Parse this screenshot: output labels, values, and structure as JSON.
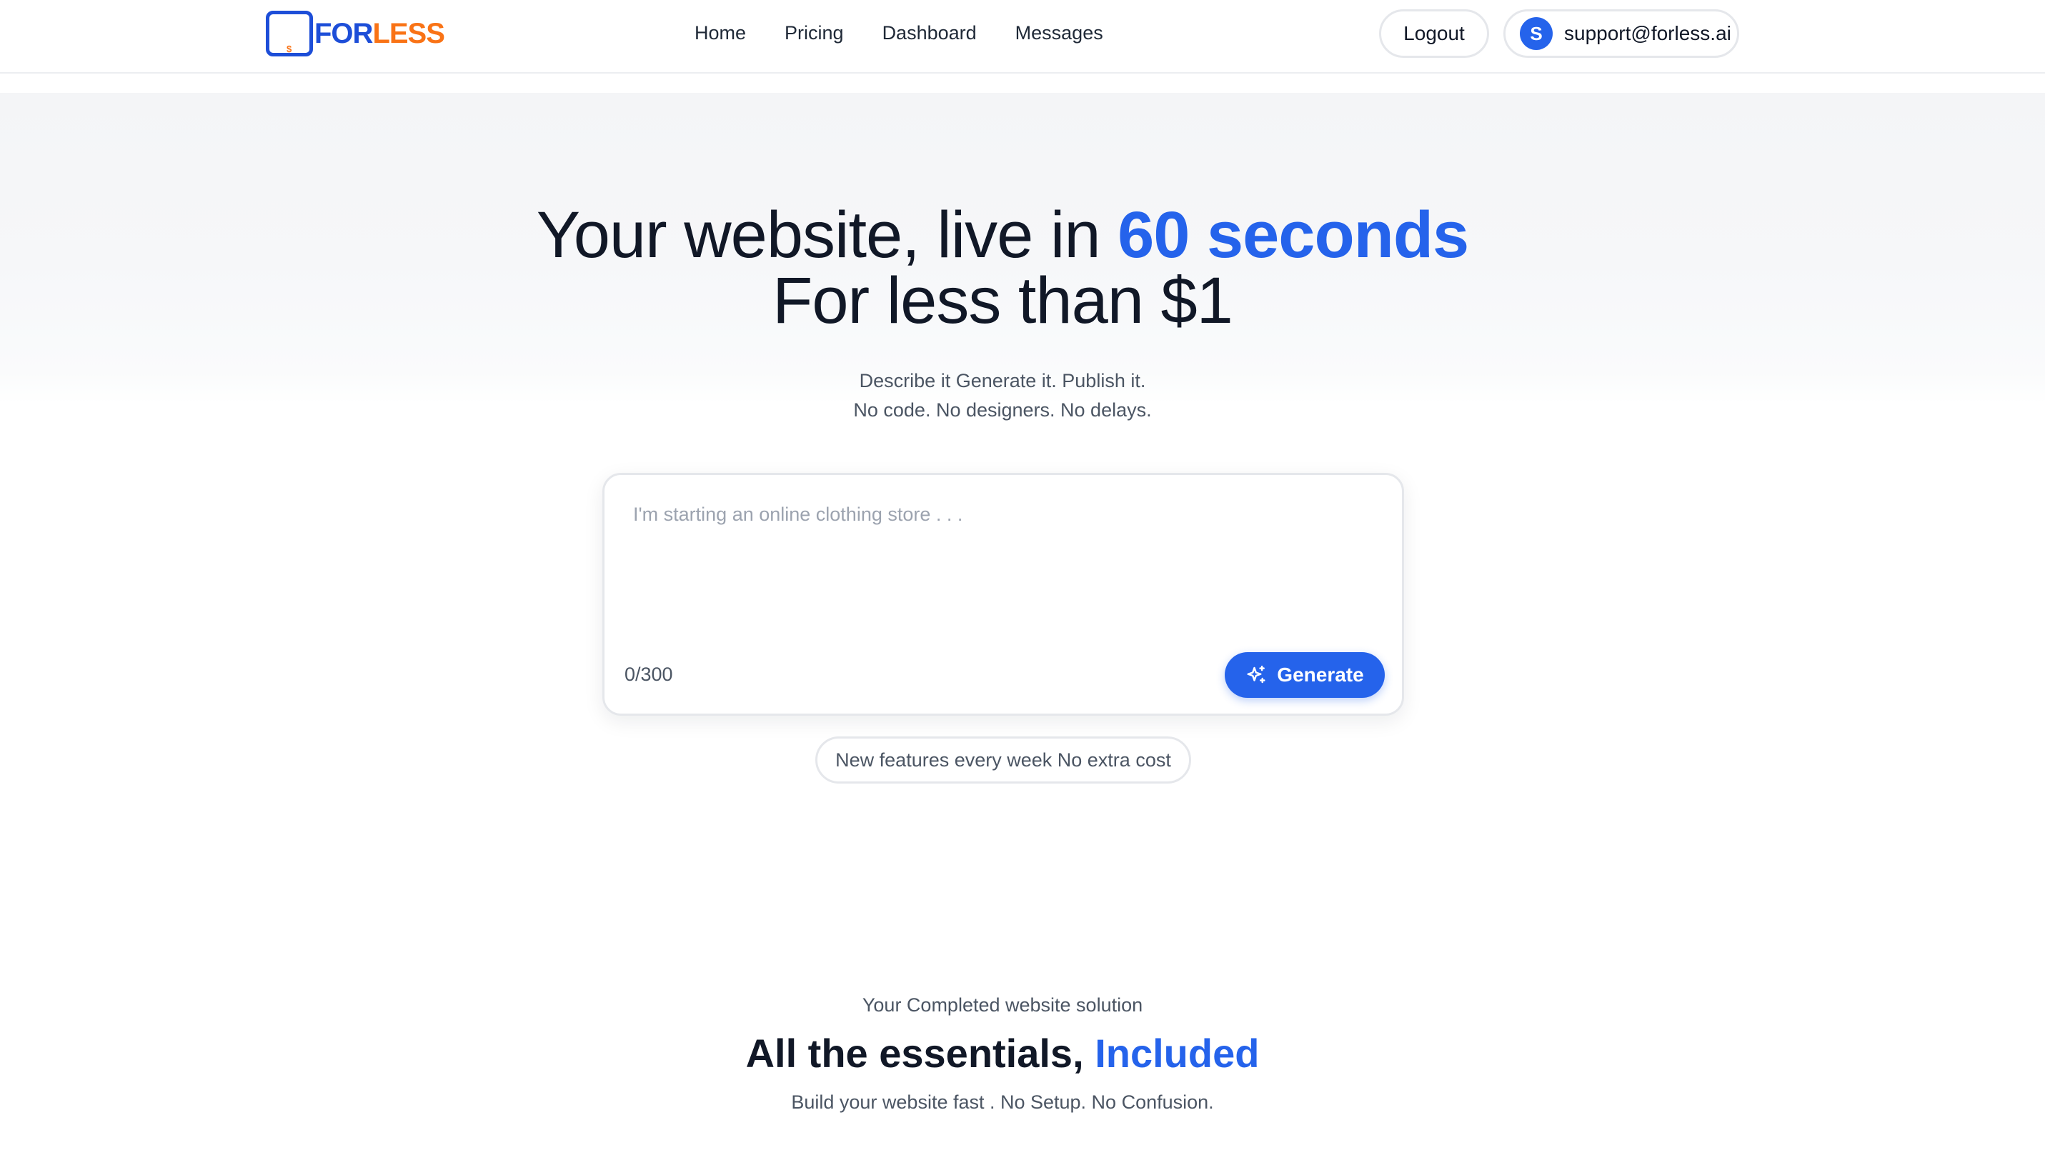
{
  "brand": {
    "logo_mark": "$",
    "name_part1": "FOR",
    "name_part2": "LESS",
    "primary_color": "#1d4ed8",
    "secondary_color": "#f97316"
  },
  "nav": {
    "items": [
      {
        "label": "Home"
      },
      {
        "label": "Pricing"
      },
      {
        "label": "Dashboard"
      },
      {
        "label": "Messages"
      }
    ]
  },
  "account": {
    "logout_label": "Logout",
    "avatar_initial": "S",
    "email": "support@forless.ai"
  },
  "hero": {
    "title_line1": "Your website, live in ",
    "title_accent": "60 seconds",
    "title_line2": "For less than $1",
    "subtitle_line1": "Describe it Generate it. Publish it.",
    "subtitle_line2": "No code. No designers. No delays.",
    "accent_color": "#2563eb"
  },
  "prompt": {
    "value": "",
    "placeholder": "I'm starting an online clothing store . . .",
    "char_count": "0/300",
    "generate_label": "Generate",
    "generate_icon": "sparkles-icon"
  },
  "features_badge": "New features every week No extra cost",
  "essentials": {
    "kicker": "Your Completed website solution",
    "title": "All the essentials, ",
    "title_accent": "Included",
    "subtitle": "Build your website fast . No Setup. No Confusion."
  }
}
